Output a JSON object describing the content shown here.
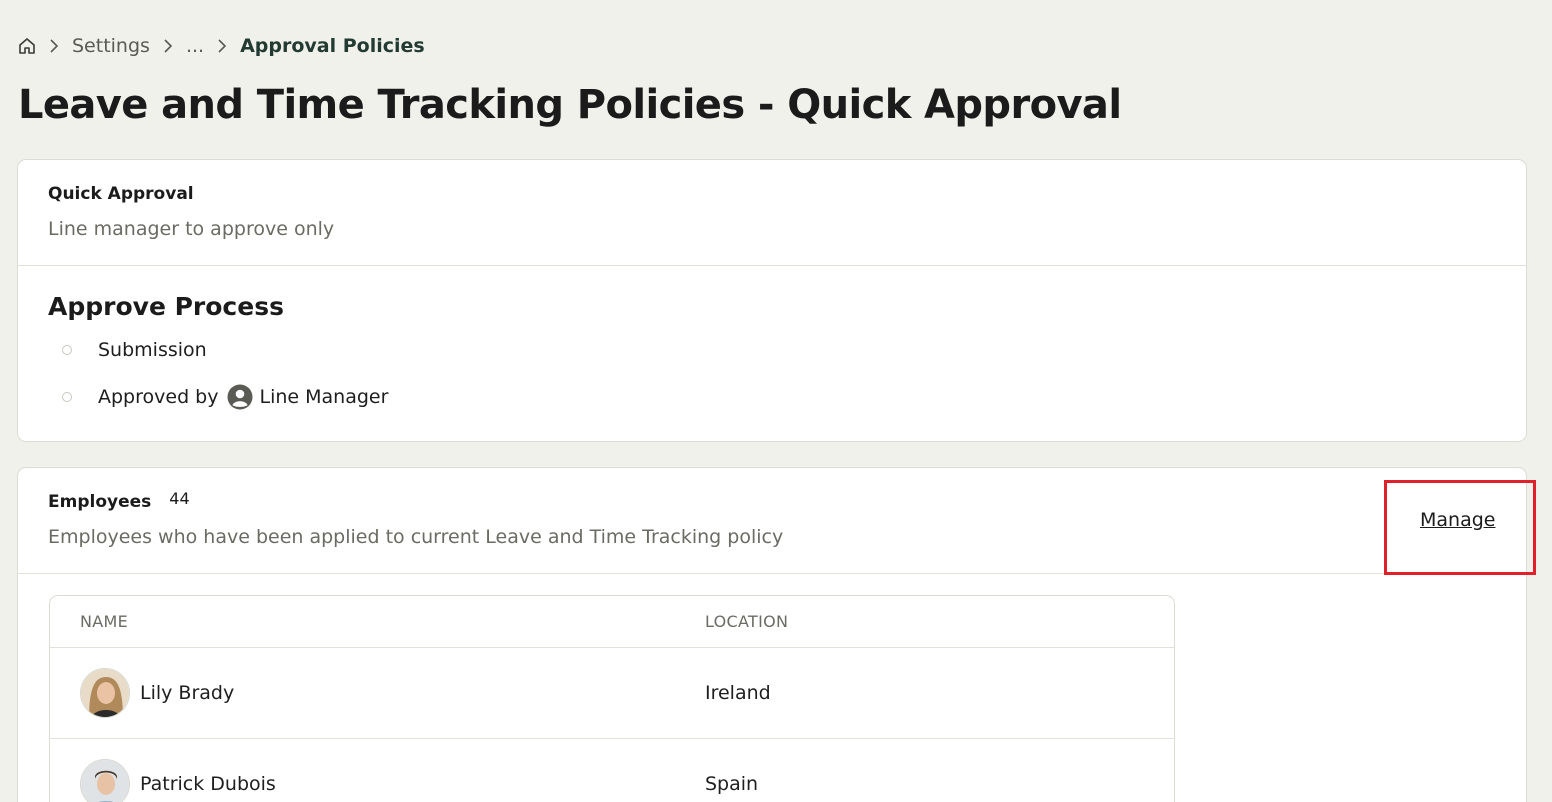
{
  "breadcrumb": {
    "home_icon": "home-icon",
    "items": [
      "Settings",
      "...",
      "Approval Policies"
    ]
  },
  "page_title": "Leave and Time Tracking Policies - Quick Approval",
  "policy_card": {
    "title": "Quick Approval",
    "subtitle": "Line manager to approve only",
    "process_title": "Approve Process",
    "steps": [
      {
        "label": "Submission"
      },
      {
        "label": "Approved by",
        "approver_icon": "user-avatar-icon",
        "approver": "Line Manager"
      }
    ]
  },
  "employees_card": {
    "title": "Employees",
    "count": "44",
    "subtitle": "Employees who have been applied to current Leave and Time Tracking policy",
    "manage_label": "Manage",
    "highlight_color": "#e0202a",
    "table": {
      "columns": [
        "NAME",
        "LOCATION"
      ],
      "rows": [
        {
          "name": "Lily Brady",
          "location": "Ireland"
        },
        {
          "name": "Patrick Dubois",
          "location": "Spain"
        }
      ]
    }
  }
}
